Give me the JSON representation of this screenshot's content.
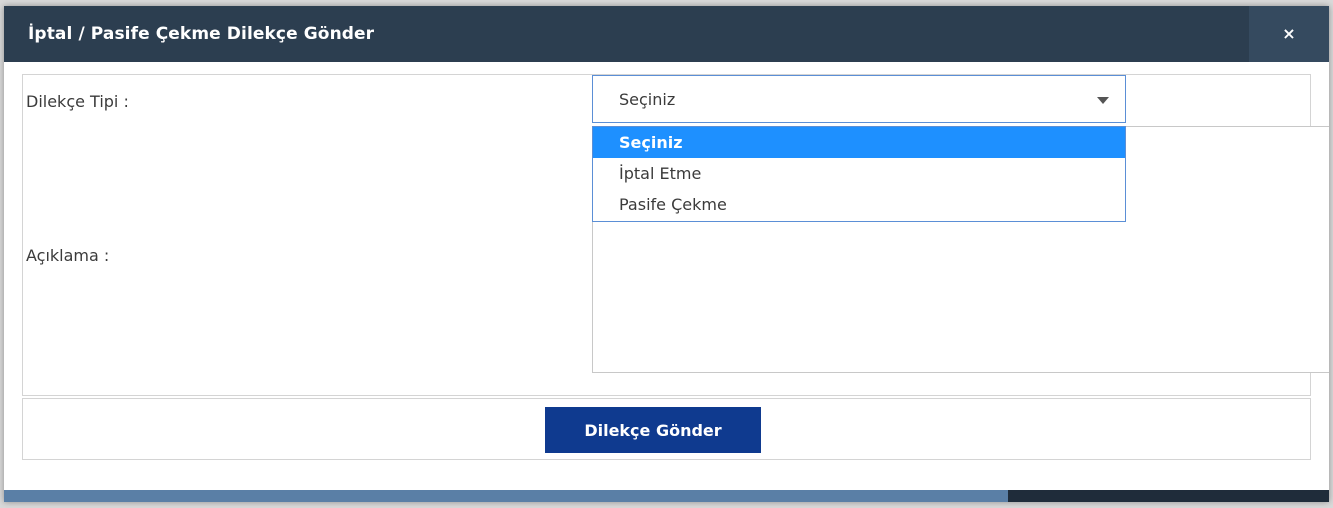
{
  "modal": {
    "title": "İptal / Pasife Çekme Dilekçe Gönder",
    "close_label": "×"
  },
  "form": {
    "type_label": "Dilekçe Tipi :",
    "description_label": "Açıklama :",
    "type_select": {
      "selected_value": "Seçiniz",
      "options": [
        "Seçiniz",
        "İptal Etme",
        "Pasife Çekme"
      ],
      "highlighted_index": 0
    },
    "description_value": ""
  },
  "footer": {
    "submit_label": "Dilekçe Gönder"
  },
  "colors": {
    "header_bg": "#2c3e50",
    "button_bg": "#0f3a8f",
    "option_highlight": "#1e90ff"
  }
}
